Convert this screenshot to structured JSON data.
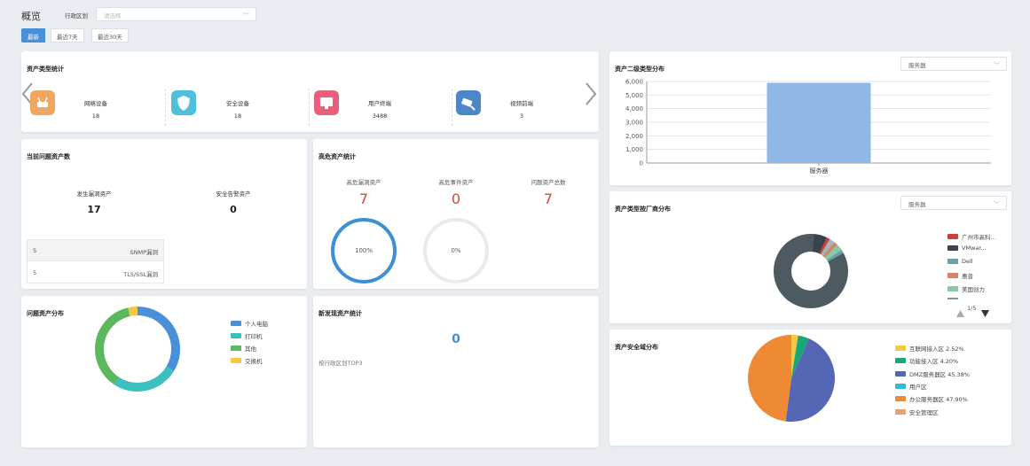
{
  "header": {
    "title": "概览",
    "region_label": "行政区划",
    "region_placeholder": "请选择"
  },
  "tabs": [
    {
      "label": "最新"
    },
    {
      "label": "最近7天"
    },
    {
      "label": "最近30天"
    }
  ],
  "asset_types": {
    "title": "资产类型统计",
    "items": [
      {
        "label": "网络设备",
        "count": "18",
        "color": "#f0a860"
      },
      {
        "label": "安全设备",
        "count": "18",
        "color": "#4fc0dc"
      },
      {
        "label": "用户终端",
        "count": "3488",
        "color": "#e8607a"
      },
      {
        "label": "视频前端",
        "count": "3",
        "color": "#4a86c8"
      }
    ]
  },
  "problem_assets": {
    "title": "当前问题资产数",
    "vuln_label": "发生漏洞资产",
    "vuln_value": "17",
    "alarm_label": "安全告警资产",
    "alarm_value": "0",
    "rows": [
      {
        "count": "5",
        "name": "SNMP漏洞"
      },
      {
        "count": "5",
        "name": "TLS/SSL漏洞"
      }
    ]
  },
  "high_risk": {
    "title": "高危资产统计",
    "cols": [
      {
        "label": "高危漏洞资产",
        "value": "7"
      },
      {
        "label": "高危事件资产",
        "value": "0"
      },
      {
        "label": "问题资产总数",
        "value": "7"
      }
    ],
    "ring1_label": "100%",
    "ring1_value": 1.0,
    "ring2_label": "0%",
    "ring2_value": 0.0
  },
  "problem_dist": {
    "title": "问题资产分布",
    "legend": [
      {
        "label": "个人电脑",
        "color": "#4a90d9"
      },
      {
        "label": "打印机",
        "color": "#3bbfbf"
      },
      {
        "label": "其他",
        "color": "#5cb85c"
      },
      {
        "label": "交换机",
        "color": "#f5c842"
      }
    ]
  },
  "new_assets": {
    "title": "新发现资产统计",
    "value": "0",
    "subtitle": "按行政区划TOP3"
  },
  "secondary_dist": {
    "title": "资产二级类型分布",
    "select": "服务器",
    "chart_data": {
      "type": "bar",
      "categories": [
        "服务器"
      ],
      "values": [
        5900
      ],
      "ylim": [
        0,
        6000
      ],
      "yticks": [
        "0",
        "1,000",
        "2,000",
        "3,000",
        "4,000",
        "5,000",
        "6,000"
      ],
      "color": "#8fb8e6"
    }
  },
  "vendor_dist": {
    "title": "资产类型按厂商分布",
    "select": "服务器",
    "legend": [
      {
        "label": "广州市高科...",
        "color": "#c9403a"
      },
      {
        "label": "VMwar...",
        "color": "#3a434d"
      },
      {
        "label": "Dell",
        "color": "#6aa0a8"
      },
      {
        "label": "惠普",
        "color": "#d9826a"
      },
      {
        "label": "美国创力",
        "color": "#8cc8a8"
      }
    ],
    "pager": "1/5"
  },
  "security_zone": {
    "title": "资产安全域分布",
    "legend": [
      {
        "label": "互联网接入区  2.52%",
        "color": "#f5c842"
      },
      {
        "label": "功能接入区  4.20%",
        "color": "#1aa57a"
      },
      {
        "label": "DMZ服务器区  45.38%",
        "color": "#5566b4"
      },
      {
        "label": "用户区",
        "color": "#38b8d8"
      },
      {
        "label": "办公服务器区  47.90%",
        "color": "#ee8a34"
      },
      {
        "label": "安全管理区",
        "color": "#e8a07a"
      }
    ],
    "chart_data": {
      "type": "pie",
      "categories": [
        "互联网接入区",
        "功能接入区",
        "DMZ服务器区",
        "办公服务器区"
      ],
      "values": [
        2.52,
        4.2,
        45.38,
        47.9
      ]
    }
  }
}
